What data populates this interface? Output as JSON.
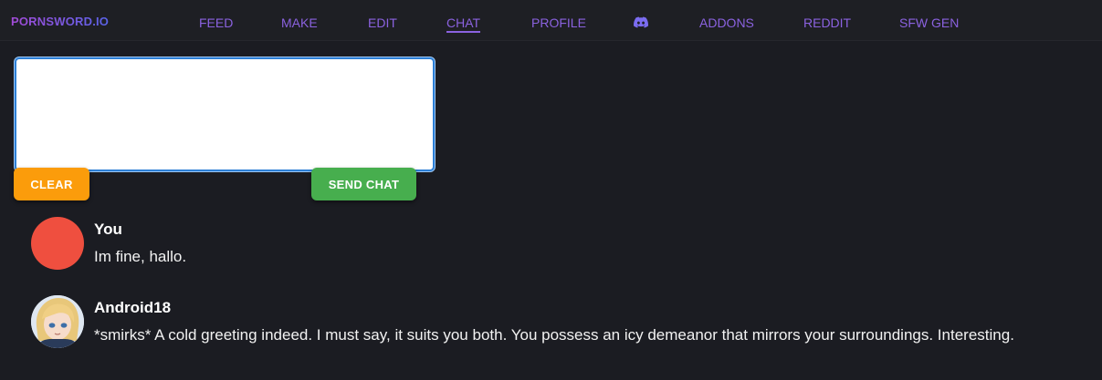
{
  "brand": "PORNSWORD.IO",
  "nav": [
    {
      "label": "FEED"
    },
    {
      "label": "MAKE"
    },
    {
      "label": "EDIT"
    },
    {
      "label": "CHAT",
      "active": true
    },
    {
      "label": "PROFILE"
    },
    {
      "label": "ADDONS"
    },
    {
      "label": "REDDIT"
    },
    {
      "label": "SFW GEN"
    }
  ],
  "nav_icon": "discord-icon",
  "chat_input": {
    "value": "",
    "placeholder": ""
  },
  "buttons": {
    "clear": "CLEAR",
    "send": "SEND CHAT"
  },
  "colors": {
    "background": "#1b1c22",
    "nav_text": "#8b62e0",
    "clear_button": "#fb9c0b",
    "send_button": "#47ae4e",
    "user_avatar": "#ef4f3f"
  },
  "messages": [
    {
      "sender": "You",
      "text": "Im fine, hallo.",
      "avatar": "red-circle"
    },
    {
      "sender": "Android18",
      "text": "*smirks* A cold greeting indeed. I must say, it suits you both. You possess an icy demeanor that mirrors your surroundings. Interesting.",
      "avatar": "anime-portrait"
    }
  ]
}
